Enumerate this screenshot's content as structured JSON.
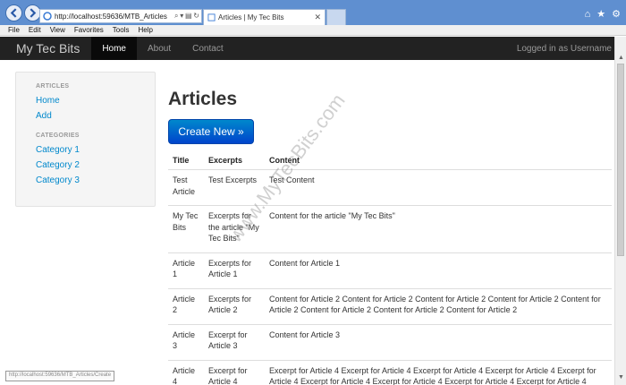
{
  "browser": {
    "url": "http://localhost:59636/MTB_Articles",
    "tab_title": "Articles | My Tec Bits",
    "menu": [
      "File",
      "Edit",
      "View",
      "Favorites",
      "Tools",
      "Help"
    ],
    "status_url": "http://localhost:59636/MTB_Articles/Create"
  },
  "site": {
    "brand": "My Tec Bits",
    "nav": [
      "Home",
      "About",
      "Contact"
    ],
    "login": "Logged in as Username"
  },
  "sidebar": {
    "articles_head": "ARTICLES",
    "articles_links": [
      "Home",
      "Add"
    ],
    "categories_head": "CATEGORIES",
    "category_links": [
      "Category 1",
      "Category 2",
      "Category 3"
    ]
  },
  "main": {
    "title": "Articles",
    "create_button": "Create New »",
    "columns": [
      "Title",
      "Excerpts",
      "Content"
    ],
    "rows": [
      {
        "title": "Test Article",
        "excerpt": "Test Excerpts",
        "content": "Test Content"
      },
      {
        "title": "My Tec Bits",
        "excerpt": "Excerpts for the article \"My Tec Bits\"",
        "content": "Content for the article \"My Tec Bits\""
      },
      {
        "title": "Article 1",
        "excerpt": "Excerpts for Article 1",
        "content": "Content for Article 1"
      },
      {
        "title": "Article 2",
        "excerpt": "Excerpts for Article 2",
        "content": "Content for Article 2 Content for Article 2 Content for Article 2 Content for Article 2 Content for Article 2 Content for Article 2 Content for Article 2 Content for Article 2"
      },
      {
        "title": "Article 3",
        "excerpt": "Excerpt for Article 3",
        "content": "Content for Article 3"
      },
      {
        "title": "Article 4",
        "excerpt": "Excerpt for Article 4",
        "content": "Excerpt for Article 4 Excerpt for Article 4 Excerpt for Article 4 Excerpt for Article 4 Excerpt for Article 4 Excerpt for Article 4 Excerpt for Article 4 Excerpt for Article 4 Excerpt for Article 4"
      }
    ]
  },
  "watermark": "www.MyTecBits.com",
  "colors": {
    "navbar": "#222222",
    "link": "#0088cc",
    "button": "#0066cc"
  }
}
